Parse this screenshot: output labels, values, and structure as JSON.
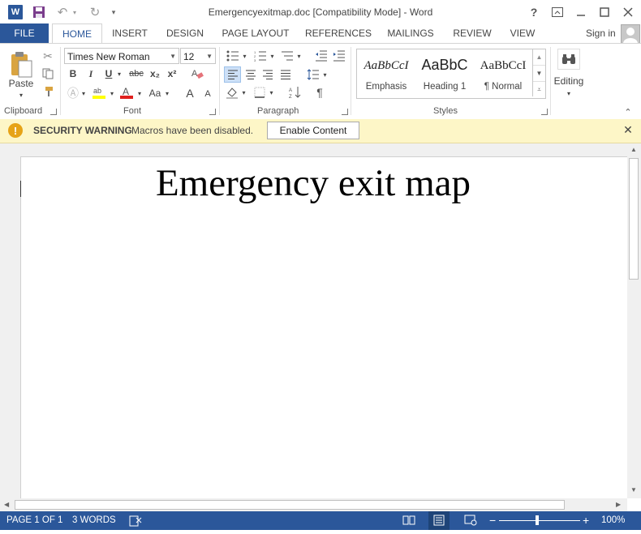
{
  "window": {
    "title": "Emergencyexitmap.doc [Compatibility Mode] - Word",
    "help": "?",
    "controls": [
      "ribbon-display",
      "minimize",
      "maximize",
      "close"
    ]
  },
  "qat": {
    "app_icon": "W"
  },
  "tabs": [
    {
      "label": "FILE"
    },
    {
      "label": "HOME"
    },
    {
      "label": "INSERT"
    },
    {
      "label": "DESIGN"
    },
    {
      "label": "PAGE LAYOUT"
    },
    {
      "label": "REFERENCES"
    },
    {
      "label": "MAILINGS"
    },
    {
      "label": "REVIEW"
    },
    {
      "label": "VIEW"
    }
  ],
  "active_tab": "HOME",
  "signin": "Sign in",
  "ribbon": {
    "clipboard": {
      "label": "Clipboard",
      "paste_label": "Paste"
    },
    "font": {
      "label": "Font",
      "font_name": "Times New Roman",
      "font_size": "12",
      "bold": "B",
      "italic": "I",
      "underline": "U",
      "strike": "abc",
      "subscript": "x₂",
      "superscript": "x²",
      "change_case": "Aa",
      "grow": "A",
      "shrink": "A"
    },
    "paragraph": {
      "label": "Paragraph",
      "pilcrow": "¶"
    },
    "styles": {
      "label": "Styles",
      "items": [
        {
          "sample": "AaBbCcI",
          "name": "Emphasis"
        },
        {
          "sample": "AaBbC",
          "name": "Heading 1"
        },
        {
          "sample": "AaBbCcI",
          "name": "¶ Normal"
        }
      ]
    },
    "editing": {
      "label": "Editing"
    }
  },
  "security_bar": {
    "title": "SECURITY WARNING",
    "message": "Macros have been disabled.",
    "button": "Enable Content",
    "icon": "!"
  },
  "document": {
    "heading": "Emergency exit map"
  },
  "status": {
    "page": "PAGE 1 OF 1",
    "words": "3 WORDS",
    "zoom": "100%",
    "zoom_minus": "−",
    "zoom_plus": "+",
    "zoom_fraction": 0.47
  },
  "colors": {
    "accent": "#2b579a",
    "warning_bg": "#fdf6c7",
    "warning_icon": "#e6a317"
  }
}
